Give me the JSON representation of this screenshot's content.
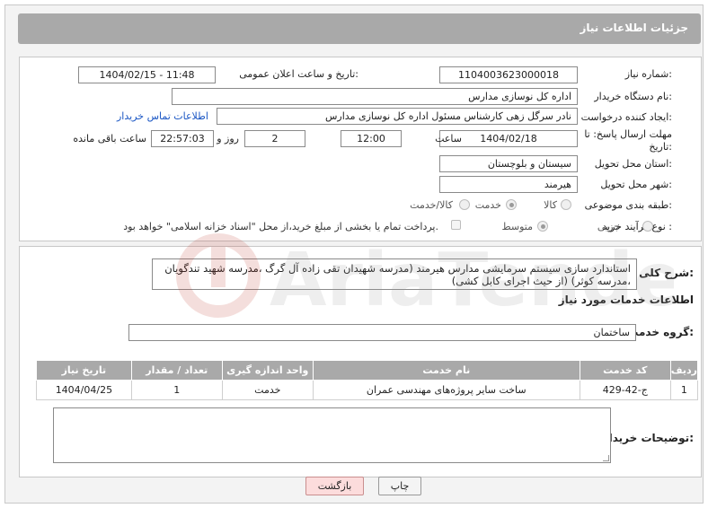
{
  "header": {
    "title": "جزئیات اطلاعات نیاز"
  },
  "form": {
    "need_number": {
      "label": "شماره نیاز:",
      "value": "1104003623000018"
    },
    "announce_datetime": {
      "label": "تاریخ و ساعت اعلان عمومی:",
      "value": "1404/02/15 - 11:48"
    },
    "buyer_org": {
      "label": "نام دستگاه خریدار:",
      "value": "اداره کل نوسازی مدارس"
    },
    "requester": {
      "label": "ایجاد کننده درخواست:",
      "value": "نادر سرگل زهی کارشناس مسئول اداره کل نوسازی مدارس",
      "contact_link": "اطلاعات تماس خریدار"
    },
    "deadline": {
      "label_line1": "مهلت ارسال پاسخ: تا",
      "label_line2": "تاریخ:",
      "date": "1404/02/18",
      "time_label": "ساعت",
      "time": "12:00",
      "days": "2",
      "days_label": "روز و",
      "remaining": "22:57:03",
      "remaining_label": "ساعت باقی مانده"
    },
    "province": {
      "label": "استان محل تحویل:",
      "value": "سیستان و بلوچستان"
    },
    "city": {
      "label": "شهر محل تحویل:",
      "value": "هیرمند"
    },
    "category": {
      "label": "طبقه بندی موضوعی:",
      "options": [
        "کالا",
        "خدمت",
        "کالا/خدمت"
      ],
      "selected": "خدمت"
    },
    "purchase_type": {
      "label": "نوع فرآیند خرید :",
      "options": [
        "جزیی",
        "متوسط"
      ],
      "selected": "متوسط",
      "payment_note": "پرداخت تمام یا بخشی از مبلغ خرید،از محل \"اسناد خزانه اسلامی\" خواهد بود."
    }
  },
  "details": {
    "summary_label": "شرح کلی نیاز:",
    "summary_text": "استاندارد سازی سیستم سرمایشی مدارس هیرمند (مدرسه شهیدان تقی زاده آل گرگ ،مدرسه شهید تندگویان ،مدرسه کوثر) (از حیث اجرای کابل کشی)",
    "services_title": "اطلاعات خدمات مورد نیاز",
    "service_group_label": "گروه خدمت:",
    "service_group": "ساختمان",
    "table": {
      "headers": [
        "ردیف",
        "کد خدمت",
        "نام خدمت",
        "واحد اندازه گیری",
        "تعداد / مقدار",
        "تاریخ نیاز"
      ],
      "rows": [
        [
          "1",
          "ج-42-429",
          "ساخت سایر پروژه‌های مهندسی عمران",
          "خدمت",
          "1",
          "1404/04/25"
        ]
      ]
    },
    "buyer_notes_label": "توضیحات خریدار:"
  },
  "buttons": {
    "print": "چاپ",
    "back": "بازگشت"
  },
  "watermark": {
    "text": "AriaTender.net"
  },
  "colors": {
    "header_bg": "#a9a9a9",
    "link": "#1a56c4",
    "back_button_bg": "#fcdcdc",
    "watermark": "#c0392b"
  }
}
